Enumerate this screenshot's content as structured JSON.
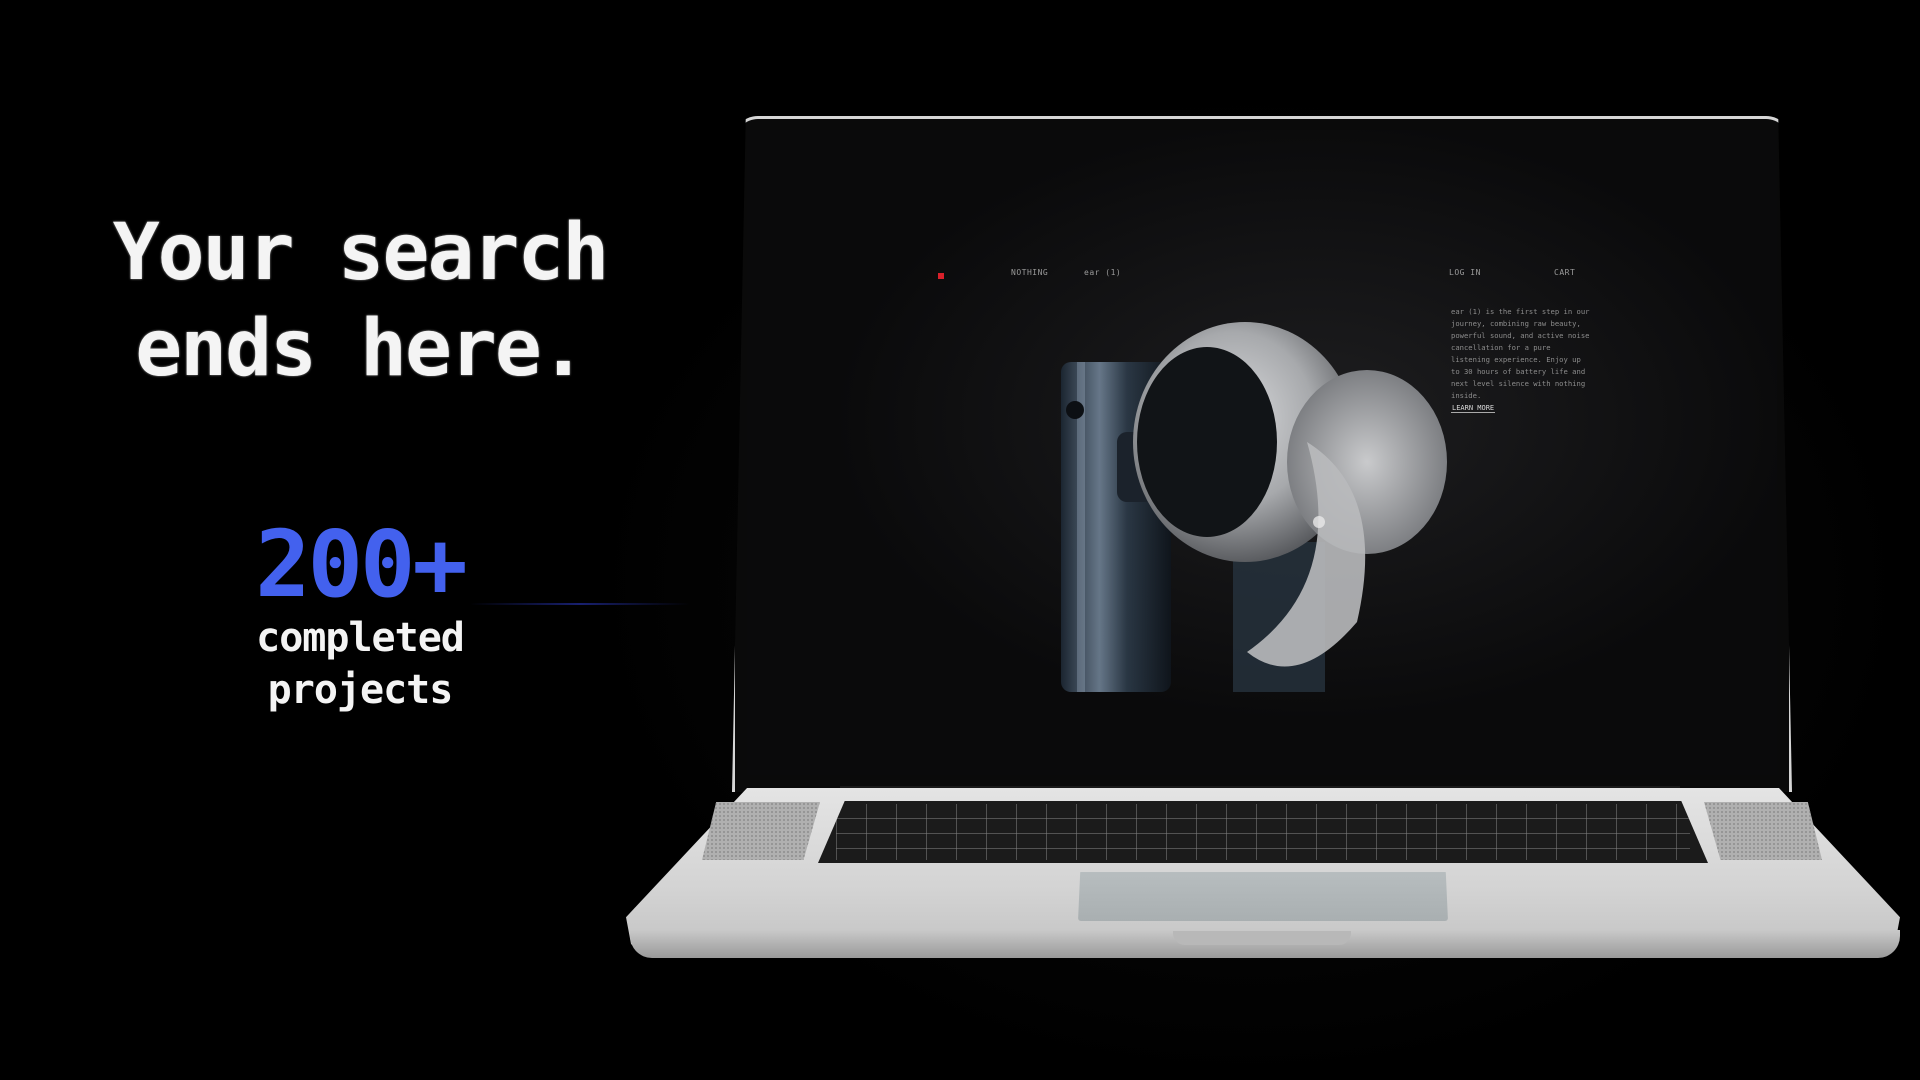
{
  "hero": {
    "title_line1": "Your search",
    "title_line2": "ends here.",
    "stat_number": "200+",
    "stat_label_line1": "completed",
    "stat_label_line2": "projects"
  },
  "screen": {
    "nav": {
      "brand": "NOTHING",
      "product": "ear (1)",
      "login": "LOG IN",
      "cart": "CART"
    },
    "description": "ear (1) is the first step in our journey, combining raw beauty, powerful sound, and active noise cancellation for a pure listening experience. Enjoy up to 30 hours of battery life and next level silence with nothing inside.",
    "cta": "LEARN MORE"
  },
  "colors": {
    "accent": "#4361ee",
    "background": "#000000",
    "text": "#f4f4f4",
    "indicator": "#d8202a"
  }
}
